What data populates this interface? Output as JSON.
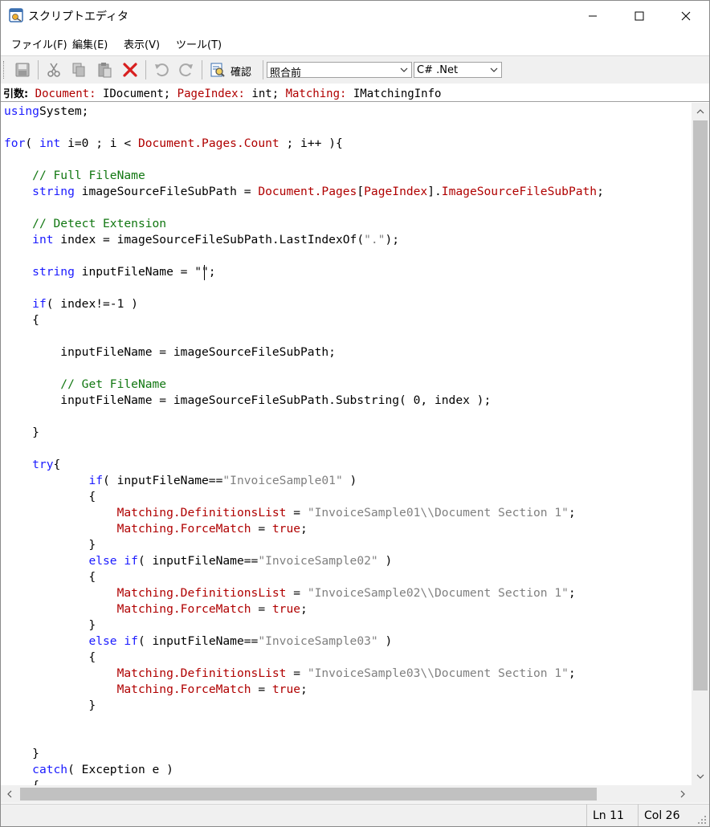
{
  "window": {
    "title": "スクリプトエディタ"
  },
  "menu": [
    {
      "label": "ファイル(F)"
    },
    {
      "label": "編集(E)"
    },
    {
      "label": "表示(V)"
    },
    {
      "label": "ツール(T)"
    }
  ],
  "toolbar": {
    "icons": [
      "save-icon",
      "cut-icon",
      "copy-icon",
      "paste-icon",
      "delete-icon",
      "undo-icon",
      "redo-icon",
      "confirm-icon"
    ],
    "confirm_label": "確認",
    "mode_select": "照合前",
    "language_select": "C# .Net"
  },
  "args": {
    "label": "引数:",
    "items": [
      {
        "name": "Document:",
        "type": "IDocument;"
      },
      {
        "name": "PageIndex:",
        "type": "int;"
      },
      {
        "name": "Matching:",
        "type": "IMatchingInfo"
      }
    ]
  },
  "code": {
    "lines": [
      [
        [
          "kw",
          "using"
        ],
        [
          "",
          "System;"
        ]
      ],
      [],
      [
        [
          "kw",
          "for"
        ],
        [
          "",
          "( "
        ],
        [
          "kw",
          "int"
        ],
        [
          "",
          " i=0 ; i < "
        ],
        [
          "rd",
          "Document.Pages.Count"
        ],
        [
          "",
          " ; i++ ){"
        ]
      ],
      [],
      [
        [
          "",
          "    "
        ],
        [
          "cm",
          "// Full FileName"
        ]
      ],
      [
        [
          "",
          "    "
        ],
        [
          "kw",
          "string"
        ],
        [
          "",
          " imageSourceFileSubPath = "
        ],
        [
          "rd",
          "Document.Pages"
        ],
        [
          "",
          "["
        ],
        [
          "rd",
          "PageIndex"
        ],
        [
          "",
          "]."
        ],
        [
          "rd",
          "ImageSourceFileSubPath"
        ],
        [
          "",
          ";"
        ]
      ],
      [],
      [
        [
          "",
          "    "
        ],
        [
          "cm",
          "// Detect Extension"
        ]
      ],
      [
        [
          "",
          "    "
        ],
        [
          "kw",
          "int"
        ],
        [
          "",
          " index = imageSourceFileSubPath.LastIndexOf("
        ],
        [
          "st",
          "\".\""
        ],
        [
          "",
          ");"
        ]
      ],
      [],
      [
        [
          "",
          "    "
        ],
        [
          "kw",
          "string"
        ],
        [
          "",
          " inputFileName = \"\";"
        ]
      ],
      [],
      [
        [
          "",
          "    "
        ],
        [
          "kw",
          "if"
        ],
        [
          "",
          "( index!=-1 )"
        ]
      ],
      [
        [
          "",
          "    {"
        ]
      ],
      [],
      [
        [
          "",
          "        inputFileName = imageSourceFileSubPath;"
        ]
      ],
      [],
      [
        [
          "",
          "        "
        ],
        [
          "cm",
          "// Get FileName"
        ]
      ],
      [
        [
          "",
          "        inputFileName = imageSourceFileSubPath.Substring( 0, index );"
        ]
      ],
      [],
      [
        [
          "",
          "    }"
        ]
      ],
      [],
      [
        [
          "",
          "    "
        ],
        [
          "kw",
          "try"
        ],
        [
          "",
          "{"
        ]
      ],
      [
        [
          "",
          "            "
        ],
        [
          "kw",
          "if"
        ],
        [
          "",
          "( inputFileName=="
        ],
        [
          "st",
          "\"InvoiceSample01\""
        ],
        [
          "",
          " )"
        ]
      ],
      [
        [
          "",
          "            {"
        ]
      ],
      [
        [
          "",
          "                "
        ],
        [
          "rd",
          "Matching.DefinitionsList"
        ],
        [
          "",
          " = "
        ],
        [
          "st",
          "\"InvoiceSample01\\\\Document Section 1\""
        ],
        [
          "",
          ";"
        ]
      ],
      [
        [
          "",
          "                "
        ],
        [
          "rd",
          "Matching.ForceMatch"
        ],
        [
          "",
          " = "
        ],
        [
          "rd",
          "true"
        ],
        [
          "",
          ";"
        ]
      ],
      [
        [
          "",
          "            }"
        ]
      ],
      [
        [
          "",
          "            "
        ],
        [
          "kw",
          "else if"
        ],
        [
          "",
          "( inputFileName=="
        ],
        [
          "st",
          "\"InvoiceSample02\""
        ],
        [
          "",
          " )"
        ]
      ],
      [
        [
          "",
          "            {"
        ]
      ],
      [
        [
          "",
          "                "
        ],
        [
          "rd",
          "Matching.DefinitionsList"
        ],
        [
          "",
          " = "
        ],
        [
          "st",
          "\"InvoiceSample02\\\\Document Section 1\""
        ],
        [
          "",
          ";"
        ]
      ],
      [
        [
          "",
          "                "
        ],
        [
          "rd",
          "Matching.ForceMatch"
        ],
        [
          "",
          " = "
        ],
        [
          "rd",
          "true"
        ],
        [
          "",
          ";"
        ]
      ],
      [
        [
          "",
          "            }"
        ]
      ],
      [
        [
          "",
          "            "
        ],
        [
          "kw",
          "else if"
        ],
        [
          "",
          "( inputFileName=="
        ],
        [
          "st",
          "\"InvoiceSample03\""
        ],
        [
          "",
          " )"
        ]
      ],
      [
        [
          "",
          "            {"
        ]
      ],
      [
        [
          "",
          "                "
        ],
        [
          "rd",
          "Matching.DefinitionsList"
        ],
        [
          "",
          " = "
        ],
        [
          "st",
          "\"InvoiceSample03\\\\Document Section 1\""
        ],
        [
          "",
          ";"
        ]
      ],
      [
        [
          "",
          "                "
        ],
        [
          "rd",
          "Matching.ForceMatch"
        ],
        [
          "",
          " = "
        ],
        [
          "rd",
          "true"
        ],
        [
          "",
          ";"
        ]
      ],
      [
        [
          "",
          "            }"
        ]
      ],
      [],
      [],
      [
        [
          "",
          "    }"
        ]
      ],
      [
        [
          "",
          "    "
        ],
        [
          "kw",
          "catch"
        ],
        [
          "",
          "( Exception e )"
        ]
      ],
      [
        [
          "",
          "    {"
        ]
      ]
    ]
  },
  "status": {
    "line": "Ln 11",
    "column": "Col 26"
  }
}
